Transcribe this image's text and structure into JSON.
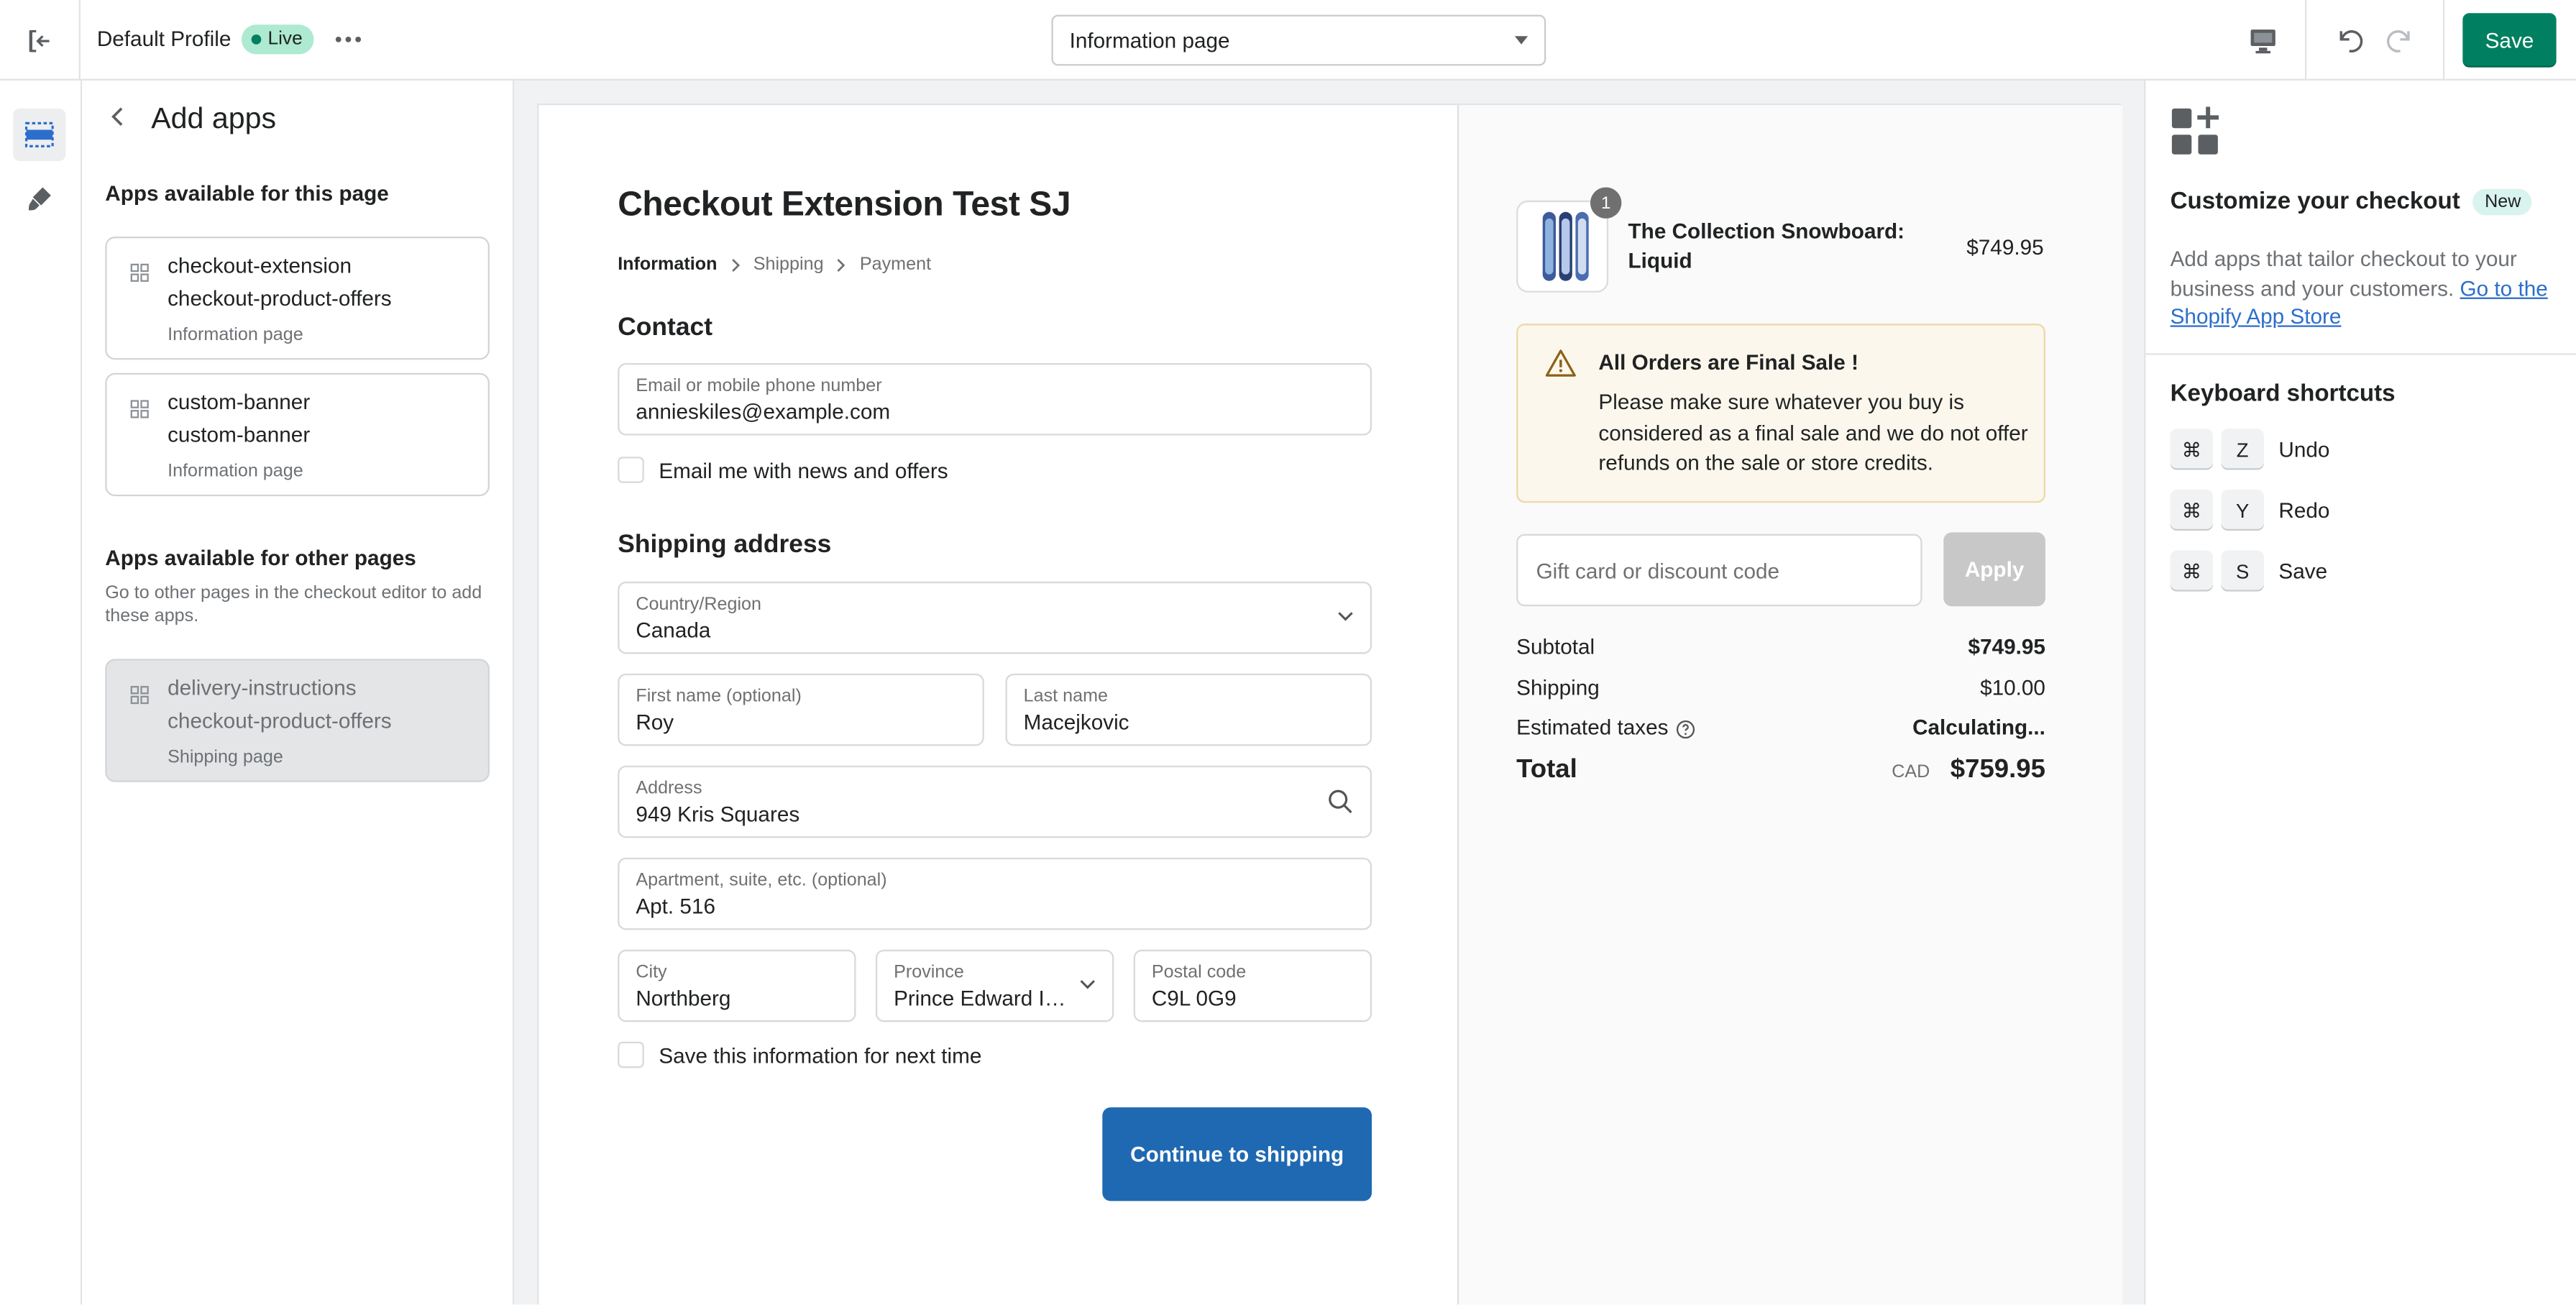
{
  "topbar": {
    "profile_name": "Default Profile",
    "status_badge": "Live",
    "page_selector": "Information page",
    "save_label": "Save"
  },
  "left_panel": {
    "title": "Add apps",
    "section_this_page": "Apps available for this page",
    "apps_this_page": [
      {
        "extension": "checkout-extension",
        "app": "checkout-product-offers",
        "page": "Information page"
      },
      {
        "extension": "custom-banner",
        "app": "custom-banner",
        "page": "Information page"
      }
    ],
    "section_other_pages": "Apps available for other pages",
    "section_other_pages_desc": "Go to other pages in the checkout editor to add these apps.",
    "apps_other_pages": [
      {
        "extension": "delivery-instructions",
        "app": "checkout-product-offers",
        "page": "Shipping page"
      }
    ]
  },
  "checkout": {
    "store_title": "Checkout Extension Test SJ",
    "breadcrumbs": [
      "Information",
      "Shipping",
      "Payment"
    ],
    "contact_heading": "Contact",
    "email_label": "Email or mobile phone number",
    "email_value": "annieskiles@example.com",
    "newsletter_label": "Email me with news and offers",
    "shipping_heading": "Shipping address",
    "country_label": "Country/Region",
    "country_value": "Canada",
    "first_name_label": "First name (optional)",
    "first_name_value": "Roy",
    "last_name_label": "Last name",
    "last_name_value": "Macejkovic",
    "address_label": "Address",
    "address_value": "949 Kris Squares",
    "apartment_label": "Apartment, suite, etc. (optional)",
    "apartment_value": "Apt. 516",
    "city_label": "City",
    "city_value": "Northberg",
    "province_label": "Province",
    "province_value": "Prince Edward Isl...",
    "postal_label": "Postal code",
    "postal_value": "C9L 0G9",
    "save_info_label": "Save this information for next time",
    "continue_label": "Continue to shipping"
  },
  "order_summary": {
    "product_name": "The Collection Snowboard: Liquid",
    "product_quantity": "1",
    "product_price": "$749.95",
    "notice_title": "All Orders are Final Sale !",
    "notice_body": "Please make sure whatever you buy is considered as a final sale and we do not offer refunds on the sale or store credits.",
    "discount_placeholder": "Gift card or discount code",
    "apply_label": "Apply",
    "subtotal_label": "Subtotal",
    "subtotal_value": "$749.95",
    "shipping_label": "Shipping",
    "shipping_value": "$10.00",
    "taxes_label": "Estimated taxes",
    "taxes_value": "Calculating...",
    "total_label": "Total",
    "total_currency": "CAD",
    "total_value": "$759.95"
  },
  "right_panel": {
    "title": "Customize your checkout",
    "new_badge": "New",
    "description": "Add apps that tailor checkout to your business and your customers.",
    "link_text": "Go to the Shopify App Store",
    "shortcuts_title": "Keyboard shortcuts",
    "shortcuts": [
      {
        "modifier": "⌘",
        "key": "Z",
        "label": "Undo"
      },
      {
        "modifier": "⌘",
        "key": "Y",
        "label": "Redo"
      },
      {
        "modifier": "⌘",
        "key": "S",
        "label": "Save"
      }
    ]
  },
  "colors": {
    "accent_green": "#008060",
    "checkout_button": "#1f69b2",
    "notice_bg": "#fcf7ec",
    "link": "#2c6ecb"
  }
}
